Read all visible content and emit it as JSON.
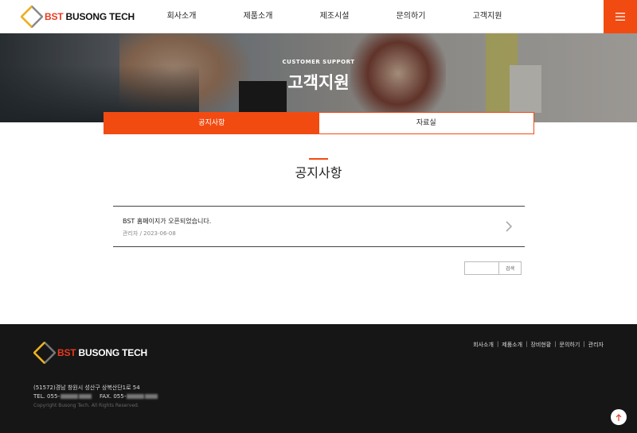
{
  "header": {
    "logo_prefix": "BST",
    "logo_name": "BUSONG TECH",
    "nav": [
      "회사소개",
      "제품소개",
      "제조시설",
      "문의하기",
      "고객지원"
    ],
    "menu_icon": "hamburger-icon"
  },
  "hero": {
    "subtitle": "CUSTOMER SUPPORT",
    "title": "고객지원"
  },
  "tabs": [
    {
      "label": "공지사항",
      "active": true
    },
    {
      "label": "자료실",
      "active": false
    }
  ],
  "section": {
    "title": "공지사항"
  },
  "posts": [
    {
      "title": "BST 홈페이지가 오픈되었습니다.",
      "author": "관리자",
      "separator": "/",
      "date": "2023-06-08"
    }
  ],
  "search": {
    "placeholder": "",
    "button_label": "검색"
  },
  "footer": {
    "logo_prefix": "BST",
    "logo_name": "BUSONG TECH",
    "links": [
      "회사소개",
      "제품소개",
      "장비현황",
      "문의하기",
      "관리자"
    ],
    "address": "(51572)경남 창원시 성산구 상복산단1로 54",
    "tel_label": "TEL. 055-",
    "fax_label": "FAX. 055-",
    "copyright": "Copyright Busong Tech. All Rights Reserved."
  },
  "colors": {
    "accent": "#f24b12",
    "footer_bg": "#161616"
  }
}
